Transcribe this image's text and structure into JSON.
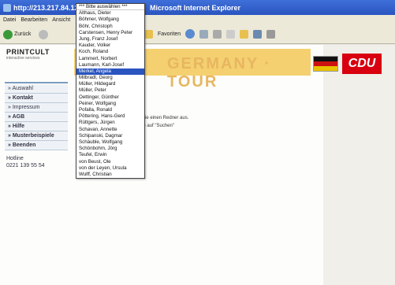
{
  "window": {
    "url": "http://213.217.84.12",
    "title": "Microsoft Internet Explorer"
  },
  "menu": [
    "Datei",
    "Bearbeiten",
    "Ansicht"
  ],
  "toolbar": {
    "back_label": "Zurück",
    "favorites_label": "Favoriten"
  },
  "header": {
    "logo": "PRINTCULT",
    "logo_sub": "interactive services",
    "banner_text": "GERMANY · TOUR",
    "party": "CDU"
  },
  "leftnav": {
    "items": [
      {
        "label": "» Auswahl",
        "bold": false
      },
      {
        "label": "» Kontakt",
        "bold": true
      },
      {
        "label": "» Impressum",
        "bold": false
      },
      {
        "label": "» AGB",
        "bold": true
      },
      {
        "label": "» Hilfe",
        "bold": true
      },
      {
        "label": "» Musterbeispiele",
        "bold": true
      },
      {
        "label": "» Beenden",
        "bold": true
      }
    ],
    "hotline_label": "Hotline",
    "hotline_number": "0221 139 55 54"
  },
  "content": {
    "line1": "Sie einen Redner aus.",
    "line2": "ie auf \"Suchen\""
  },
  "dropdown": {
    "selected_index": 13,
    "options": [
      "*** Bitte auswählen ***",
      "Althaus, Dieter",
      "Böhmer, Wolfgang",
      "Böhr, Christoph",
      "Carstensen, Henry Peter",
      "Jung, Franz Josef",
      "Kauder, Volker",
      "Koch, Roland",
      "Lammert, Norbert",
      "Laumann, Karl-Josef",
      "Merkel, Angela",
      "Milbradt, Georg",
      "Müller, Hildegard",
      "Müller, Peter",
      "Oettinger, Günther",
      "Peiner, Wolfgang",
      "Pofalla, Ronald",
      "Pöttering, Hans-Gerd",
      "Rüttgers, Jürgen",
      "Schavan, Annette",
      "Schipanski, Dagmar",
      "Schäuble, Wolfgang",
      "Schönbohm, Jörg",
      "Teufel, Erwin",
      "von Beust, Ole",
      "von der Leyen, Ursula",
      "Wulff, Christian"
    ]
  }
}
